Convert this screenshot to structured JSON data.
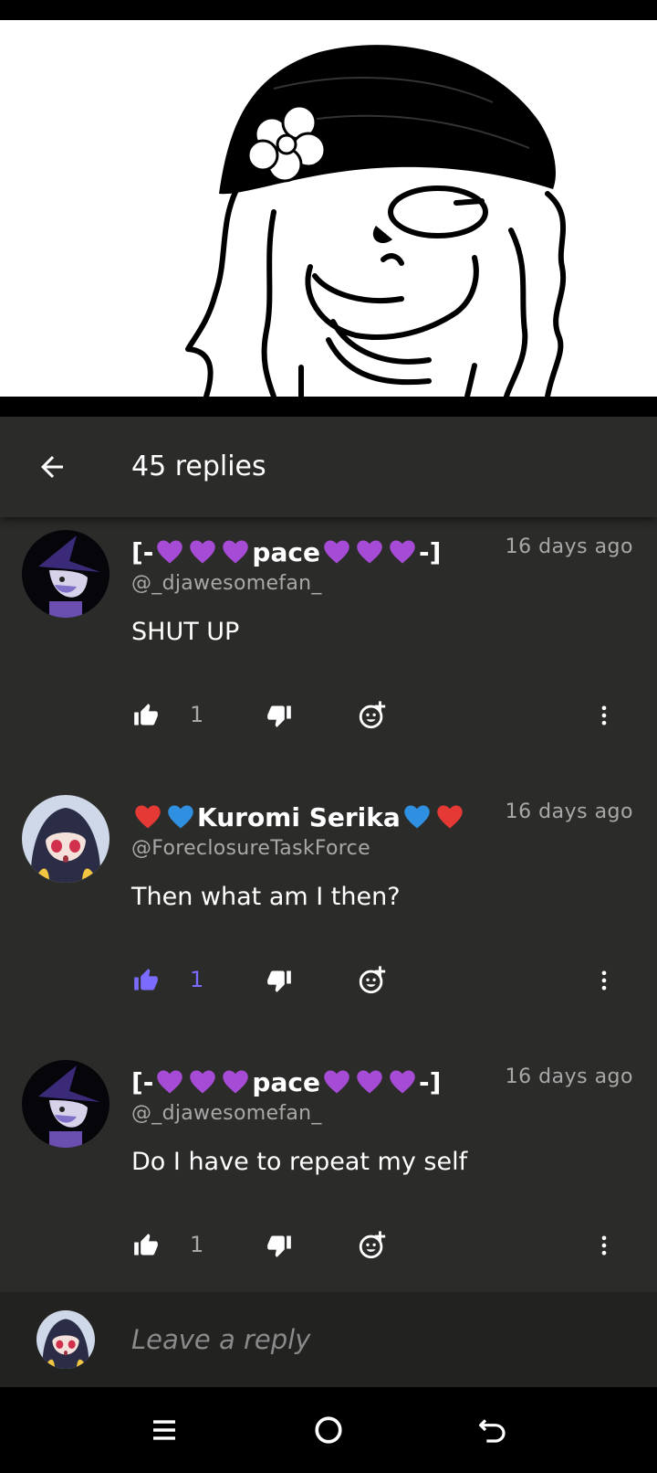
{
  "header": {
    "title": "45 replies"
  },
  "comments": [
    {
      "name_prefix": "[-",
      "name_core": "pace",
      "name_suffix": "-]",
      "handle": "@_djawesomefan_",
      "time": "16 days ago",
      "text": "SHUT UP",
      "likes": "1",
      "liked": false,
      "avatar": "witch-cat-avatar"
    },
    {
      "name_core": "Kuromi Serika",
      "handle": "@ForeclosureTaskForce",
      "time": "16 days ago",
      "text": "Then what am I then?",
      "likes": "1",
      "liked": true,
      "avatar": "anime-girl-avatar"
    },
    {
      "name_prefix": "[-",
      "name_core": "pace",
      "name_suffix": "-]",
      "handle": "@_djawesomefan_",
      "time": "16 days ago",
      "text": "Do I have to repeat my self",
      "likes": "1",
      "liked": false,
      "avatar": "witch-cat-avatar"
    }
  ],
  "reply": {
    "placeholder": "Leave a reply"
  },
  "colors": {
    "background": "#2b2b29",
    "liked_accent": "#7b6cff",
    "purple_heart": "#a64bd6",
    "red_heart": "#e53935",
    "blue_heart": "#2f8fe0"
  },
  "icons": [
    "back-arrow-icon",
    "thumbs-up-icon",
    "thumbs-down-icon",
    "add-reaction-icon",
    "more-vert-icon",
    "menu-icon",
    "home-circle-icon",
    "back-nav-icon"
  ]
}
